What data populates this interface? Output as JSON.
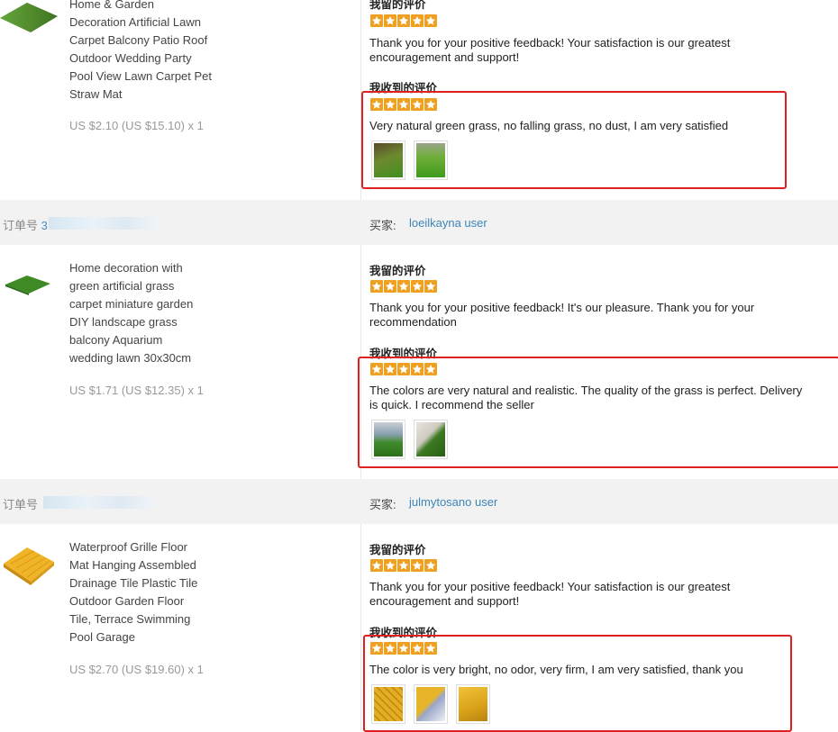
{
  "orders": [
    {
      "product": {
        "title_lines": [
          "Home & Garden",
          "Decoration Artificial Lawn",
          "Carpet Balcony Patio Roof",
          "Outdoor Wedding Party",
          "Pool View Lawn Carpet Pet",
          "Straw Mat"
        ],
        "price": "US $2.10 (US $15.10) x 1",
        "thumb_icon": "grass-mat-image"
      },
      "my_review": {
        "label": "我留的评价",
        "stars": 5,
        "text_lines": [
          "Thank you for your positive feedback! Your satisfaction is our greatest",
          "encouragement and support!"
        ]
      },
      "received_review": {
        "label": "我收到的评价",
        "stars": 5,
        "text_lines": [
          "Very natural green grass, no falling grass, no dust, I am very satisfied"
        ],
        "photos": [
          "grass-photo-1",
          "grass-photo-2"
        ]
      }
    },
    {
      "order_label": "订单号",
      "order_number_visible": "3",
      "buyer_label": "买家:",
      "buyer_name": "loeilkayna user",
      "product": {
        "title_lines": [
          "Home decoration with",
          "green artificial grass",
          "carpet miniature garden",
          "DIY landscape grass",
          "balcony Aquarium",
          "wedding lawn 30x30cm"
        ],
        "price": "US $1.71 (US $12.35) x 1",
        "thumb_icon": "grass-tile-image"
      },
      "my_review": {
        "label": "我留的评价",
        "stars": 5,
        "text_lines": [
          "Thank you for your positive feedback! It's our pleasure. Thank you for your",
          "recommendation"
        ]
      },
      "received_review": {
        "label": "我收到的评价",
        "stars": 5,
        "text_lines": [
          "The colors are very natural and realistic. The quality of the grass is perfect. Delivery",
          "is quick. I recommend the seller"
        ],
        "photos": [
          "lawn-photo-1",
          "lawn-photo-2"
        ]
      }
    },
    {
      "order_label": "订单号",
      "order_number_visible": "",
      "buyer_label": "买家:",
      "buyer_name": "julmytosano user",
      "product": {
        "title_lines": [
          "Waterproof Grille Floor",
          "Mat Hanging Assembled",
          "Drainage Tile Plastic Tile",
          "Outdoor Garden Floor",
          "Tile, Terrace Swimming",
          "Pool Garage"
        ],
        "price": "US $2.70 (US $19.60) x 1",
        "thumb_icon": "yellow-tile-image"
      },
      "my_review": {
        "label": "我留的评价",
        "stars": 5,
        "text_lines": [
          "Thank you for your positive feedback! Your satisfaction is our greatest",
          "encouragement and support!"
        ]
      },
      "received_review": {
        "label": "我收到的评价",
        "stars": 5,
        "text_lines": [
          "The color is very bright, no odor, very firm, I am very satisfied, thank you"
        ],
        "photos": [
          "tile-photo-1",
          "tile-photo-2",
          "tile-photo-3"
        ]
      }
    }
  ],
  "colors": {
    "star": "#f0a020",
    "highlight_box": "#e02020",
    "link": "#3d86b8",
    "order_bar": "#f2f2f2"
  }
}
